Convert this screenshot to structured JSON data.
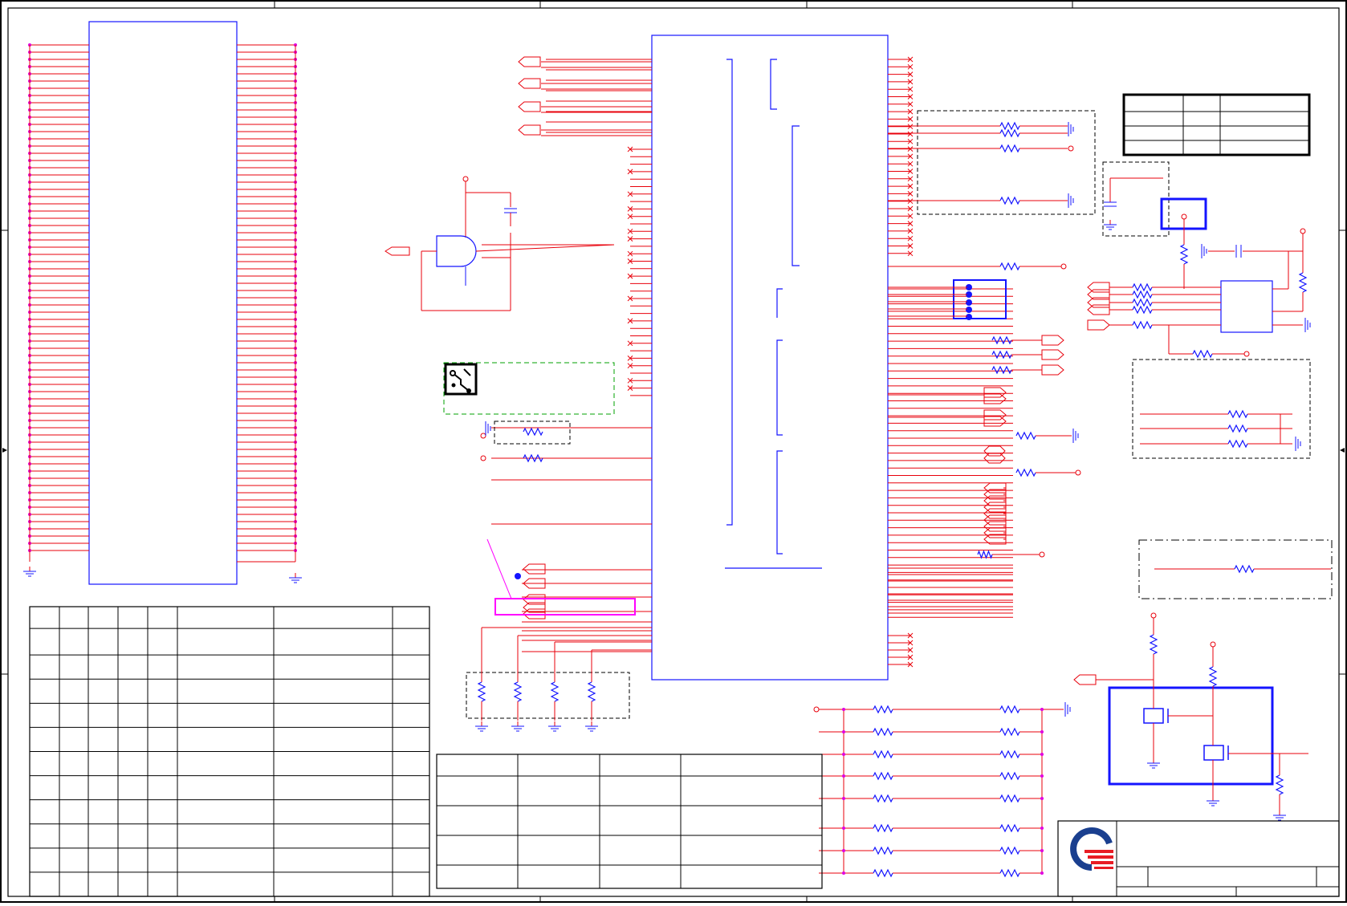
{
  "sheet": {
    "kind": "schematic",
    "zones_horizontal": 5,
    "zones_vertical": 4,
    "border_markers": [
      "left-arrow",
      "right-arrow"
    ]
  },
  "colors": {
    "net": "#e8000b",
    "component": "#1414ff",
    "pin_dot": "#e000e0",
    "border": "#000000",
    "highlight": "#ff00ff",
    "pcb_box": "#00a000",
    "logo_blue": "#1a3f8f",
    "logo_red": "#e81c24"
  },
  "icons": [
    "pcb-icon",
    "company-logo",
    "ground-symbol",
    "resistor-symbol",
    "capacitor-symbol",
    "no-connect-marker",
    "off-page-connector",
    "and-gate",
    "mosfet-symbol"
  ],
  "tables": {
    "revision_table": {
      "rows": 12,
      "cols": 8
    },
    "approval_table": {
      "rows": 5,
      "cols": 4
    },
    "option_table": {
      "rows": 4,
      "cols": 3
    },
    "title_block": {
      "rows": 3
    }
  }
}
